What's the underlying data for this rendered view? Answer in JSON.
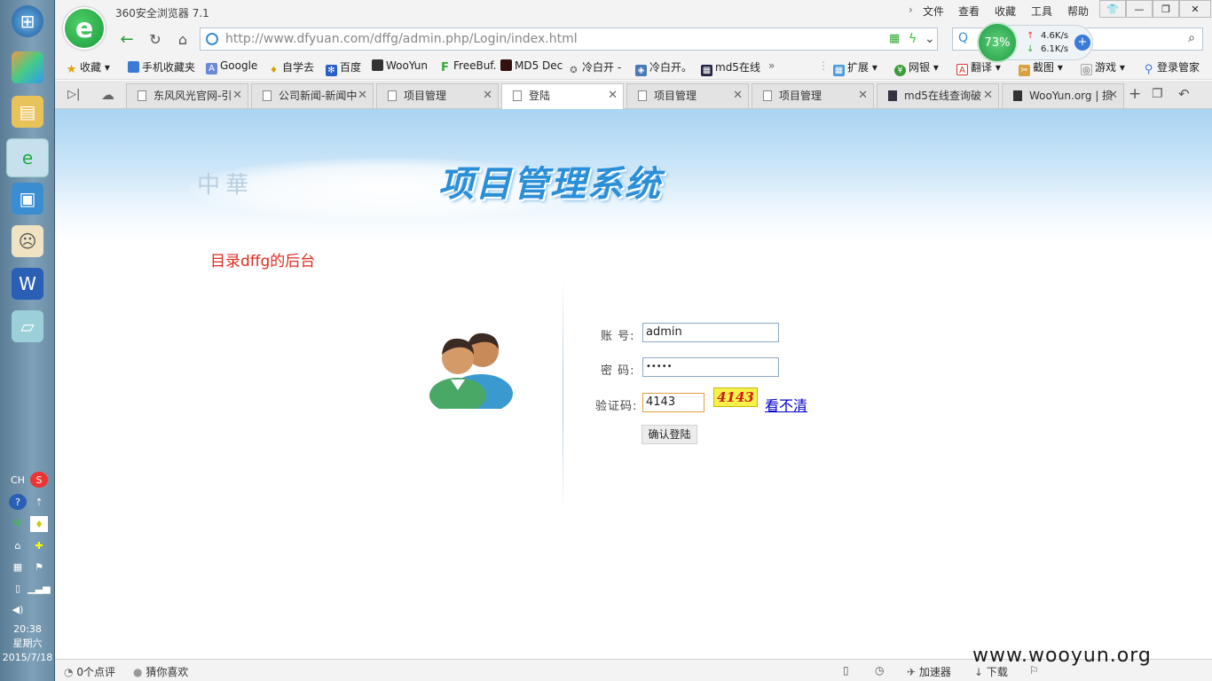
{
  "app": {
    "title": "360安全浏览器 7.1"
  },
  "menu": [
    "文件",
    "查看",
    "收藏",
    "工具",
    "帮助"
  ],
  "address": {
    "url": "http://www.dfyuan.com/dffg/admin.php/Login/index.html",
    "domain_part": "dfyuan.com"
  },
  "speed": {
    "percent": "73%",
    "up": "4.6K/s",
    "down": "6.1K/s"
  },
  "bookmarks": {
    "left": [
      "收藏",
      "手机收藏夹",
      "Google",
      "自学去",
      "百度",
      "WooYun",
      "FreeBuf.",
      "MD5 Dec",
      "冷白开 -",
      "冷白开。",
      "md5在线"
    ],
    "right": [
      "扩展",
      "网银",
      "翻译",
      "截图",
      "游戏",
      "登录管家"
    ]
  },
  "tabs": [
    "东风风光官网-引",
    "公司新闻-新闻中",
    "项目管理",
    "登陆",
    "项目管理",
    "项目管理",
    "md5在线查询破",
    "WooYun.org | 损"
  ],
  "page": {
    "system_title": "项目管理系统",
    "faint_text": "中華",
    "red_note": "目录dffg的后台",
    "labels": {
      "account": "账  号:",
      "password": "密  码:",
      "captcha": "验证码:"
    },
    "values": {
      "account": "admin",
      "password": "•••••",
      "captcha": "4143"
    },
    "captcha_image_text": "4143",
    "refresh_link": "看不清",
    "submit": "确认登陆"
  },
  "status": {
    "comments": "0个点评",
    "guess": "猜你喜欢",
    "accelerator": "加速器",
    "download": "下载"
  },
  "taskbar": {
    "lang": "CH",
    "time": "20:38",
    "weekday": "星期六",
    "date": "2015/7/18"
  },
  "watermark": "www.wooyun.org",
  "colors": {
    "accent": "#2b8fd8",
    "red_note": "#e02b20",
    "captcha_bg": "#f7f24a"
  }
}
